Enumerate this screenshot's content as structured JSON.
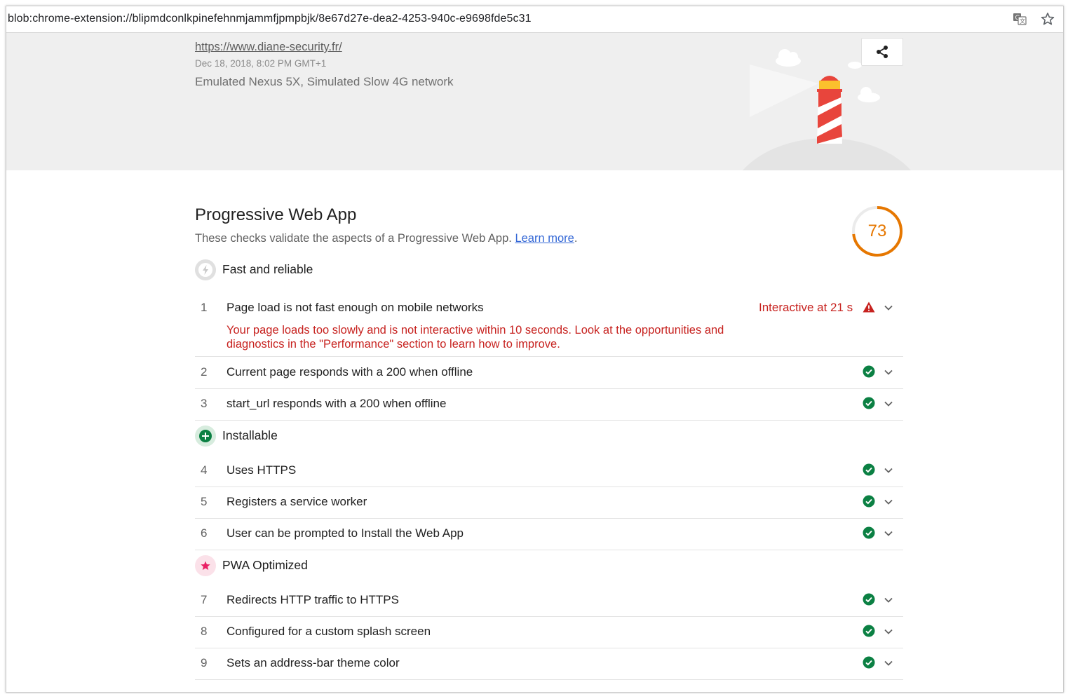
{
  "browser": {
    "address": "blob:chrome-extension://blipmdconlkpinefehnmjammfjpmpbjk/8e67d27e-dea2-4253-940c-e9698fde5c31",
    "icons": [
      "translate-icon",
      "star-icon"
    ]
  },
  "report_header": {
    "url": "https://www.diane-security.fr/",
    "date": "Dec 18, 2018, 8:02 PM GMT+1",
    "environment": "Emulated Nexus 5X, Simulated Slow 4G network"
  },
  "category": {
    "title": "Progressive Web App",
    "description": "These checks validate the aspects of a Progressive Web App.",
    "learn_more": "Learn more",
    "period": ".",
    "score": "73",
    "score_fraction": 0.73,
    "score_color": "#e67700"
  },
  "groups": [
    {
      "title": "Fast and reliable",
      "icon": "lightning-icon",
      "audits": [
        {
          "num": "1",
          "title": "Page load is not fast enough on mobile networks",
          "status": "fail",
          "display_value": "Interactive at 21 s",
          "explanation": "Your page loads too slowly and is not interactive within 10 seconds. Look at the opportunities and diagnostics in the \"Performance\" section to learn how to improve."
        },
        {
          "num": "2",
          "title": "Current page responds with a 200 when offline",
          "status": "pass"
        },
        {
          "num": "3",
          "title": "start_url responds with a 200 when offline",
          "status": "pass"
        }
      ]
    },
    {
      "title": "Installable",
      "icon": "plus-icon",
      "audits": [
        {
          "num": "4",
          "title": "Uses HTTPS",
          "status": "pass"
        },
        {
          "num": "5",
          "title": "Registers a service worker",
          "status": "pass"
        },
        {
          "num": "6",
          "title": "User can be prompted to Install the Web App",
          "status": "pass"
        }
      ]
    },
    {
      "title": "PWA Optimized",
      "icon": "star-icon",
      "audits": [
        {
          "num": "7",
          "title": "Redirects HTTP traffic to HTTPS",
          "status": "pass"
        },
        {
          "num": "8",
          "title": "Configured for a custom splash screen",
          "status": "pass"
        },
        {
          "num": "9",
          "title": "Sets an address-bar theme color",
          "status": "pass"
        }
      ]
    }
  ],
  "colors": {
    "pass": "#0b8043",
    "fail": "#c7221f",
    "average": "#e67700",
    "link": "#3367d6"
  }
}
